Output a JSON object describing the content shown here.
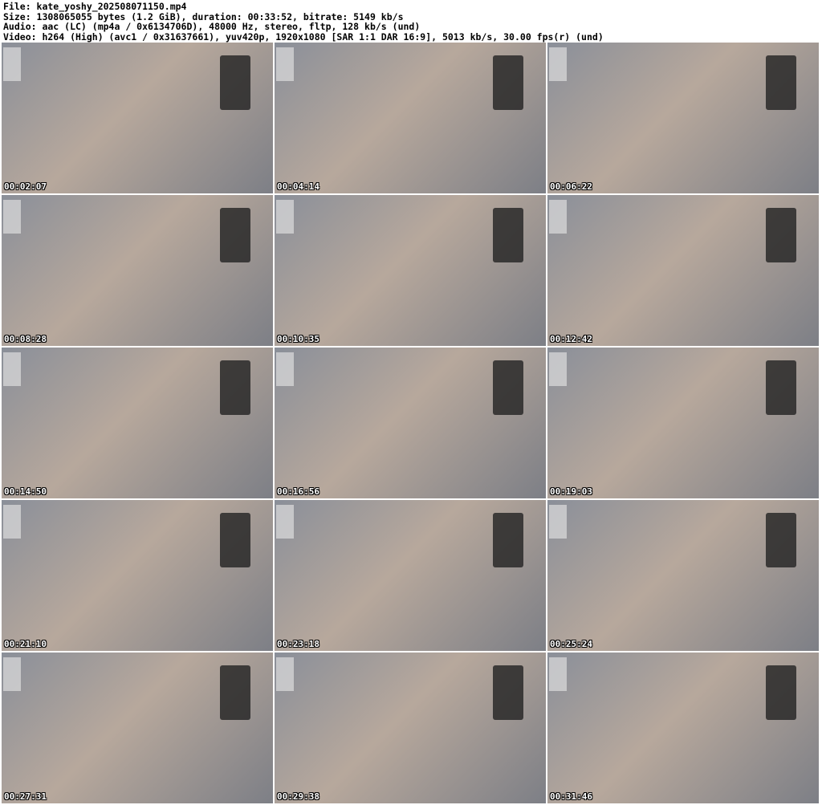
{
  "header": {
    "file": "File: kate_yoshy_202508071150.mp4",
    "size": "Size: 1308065055 bytes (1.2 GiB), duration: 00:33:52, bitrate: 5149 kb/s",
    "audio": "Audio: aac (LC) (mp4a / 0x6134706D), 48000 Hz, stereo, fltp, 128 kb/s (und)",
    "video": "Video: h264 (High) (avc1 / 0x31637661), yuv420p, 1920x1080 [SAR 1:1 DAR 16:9], 5013 kb/s, 30.00 fps(r) (und)"
  },
  "thumbnails": [
    {
      "time": "00:02:07"
    },
    {
      "time": "00:04:14"
    },
    {
      "time": "00:06:22"
    },
    {
      "time": "00:08:28"
    },
    {
      "time": "00:10:35"
    },
    {
      "time": "00:12:42"
    },
    {
      "time": "00:14:50"
    },
    {
      "time": "00:16:56"
    },
    {
      "time": "00:19:03"
    },
    {
      "time": "00:21:10"
    },
    {
      "time": "00:23:18"
    },
    {
      "time": "00:25:24"
    },
    {
      "time": "00:27:31"
    },
    {
      "time": "00:29:38"
    },
    {
      "time": "00:31:46"
    }
  ]
}
